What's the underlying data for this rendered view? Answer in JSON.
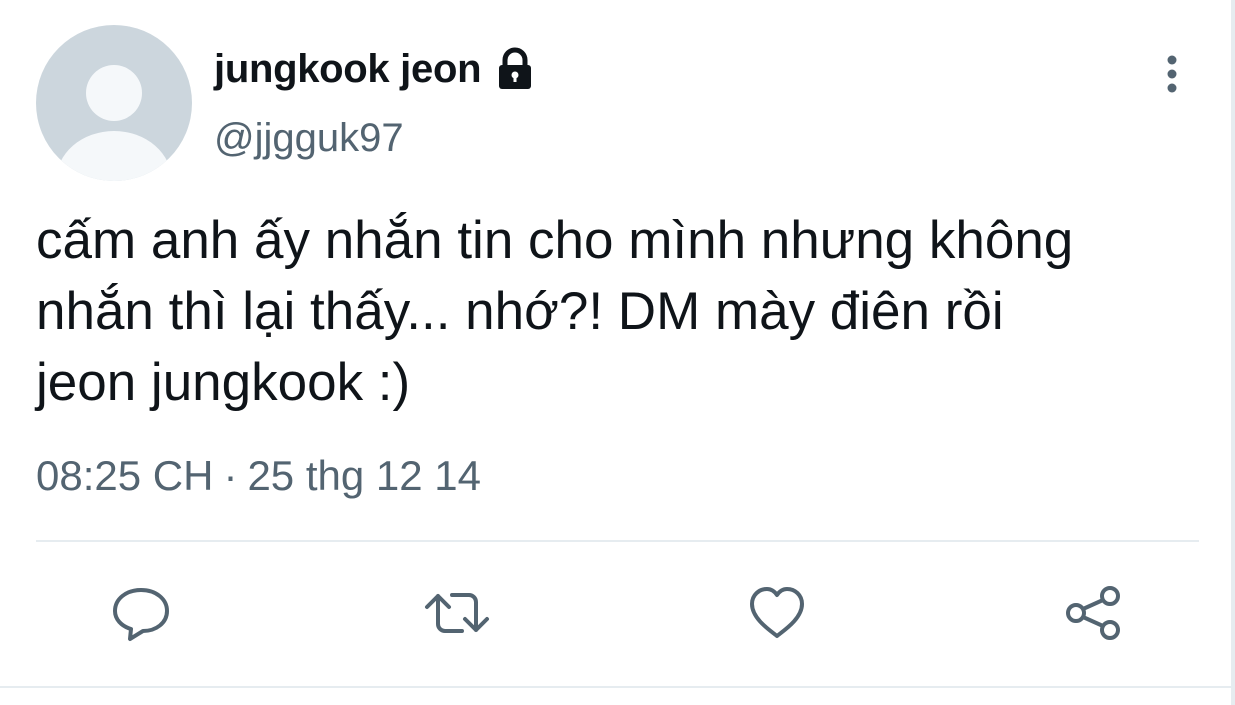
{
  "tweet": {
    "display_name": "jungkook jeon",
    "handle": "@jjgguk97",
    "text": "cấm anh ấy nhắn tin cho mình nhưng không\nnhắn thì lại thấy... nhớ?! DM mày điên rồi\njeon jungkook :)",
    "time": "08:25 CH",
    "separator": "·",
    "date": "25 thg 12 14"
  },
  "icons": {
    "protected": "lock-icon",
    "menu": "more-vertical-icon",
    "reply": "reply-icon",
    "retweet": "retweet-icon",
    "like": "heart-icon",
    "share": "share-icon"
  },
  "colors": {
    "text_primary": "#0f1419",
    "text_secondary": "#536471",
    "icon": "#536471",
    "divider": "#e6ecf0",
    "avatar_bg": "#ccd6dd"
  }
}
